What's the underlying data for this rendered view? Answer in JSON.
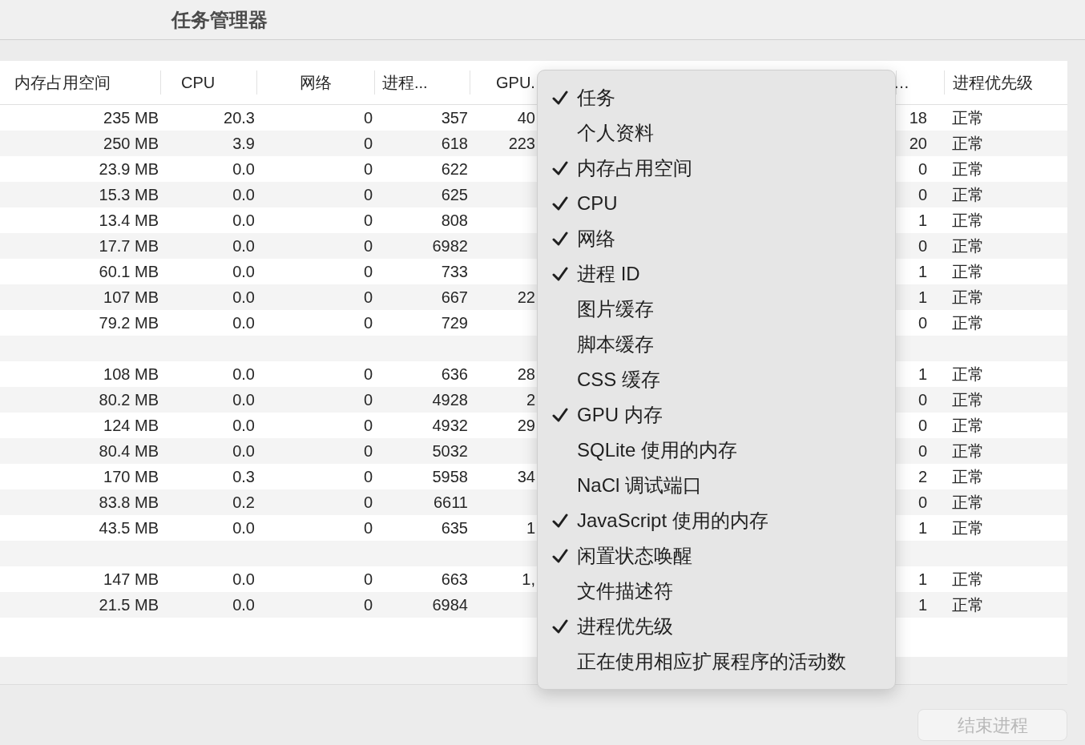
{
  "window": {
    "title": "任务管理器"
  },
  "table": {
    "columns": [
      "内存占用空间",
      "CPU",
      "网络",
      "进程...",
      "GPU.",
      "…",
      "进程优先级"
    ],
    "rows": [
      {
        "kind": "process",
        "memory": "235 MB",
        "cpu": "20.3",
        "network": "0",
        "pid": "357",
        "gpu": "40",
        "column_7": "18",
        "priority": "正常"
      },
      {
        "kind": "process",
        "memory": "250 MB",
        "cpu": "3.9",
        "network": "0",
        "pid": "618",
        "gpu": "223",
        "column_7": "20",
        "priority": "正常"
      },
      {
        "kind": "process",
        "memory": "23.9 MB",
        "cpu": "0.0",
        "network": "0",
        "pid": "622",
        "column_7": "0",
        "priority": "正常"
      },
      {
        "kind": "process",
        "memory": "15.3 MB",
        "cpu": "0.0",
        "network": "0",
        "pid": "625",
        "column_7": "0",
        "priority": "正常"
      },
      {
        "kind": "process",
        "memory": "13.4 MB",
        "cpu": "0.0",
        "network": "0",
        "pid": "808",
        "column_7": "1",
        "priority": "正常"
      },
      {
        "kind": "process",
        "memory": "17.7 MB",
        "cpu": "0.0",
        "network": "0",
        "pid": "6982",
        "column_7": "0",
        "priority": "正常"
      },
      {
        "kind": "process",
        "memory": "60.1 MB",
        "cpu": "0.0",
        "network": "0",
        "pid": "733",
        "column_7": "1",
        "priority": "正常"
      },
      {
        "kind": "process",
        "memory": "107 MB",
        "cpu": "0.0",
        "network": "0",
        "pid": "667",
        "gpu": "22",
        "column_7": "1",
        "priority": "正常"
      },
      {
        "kind": "process",
        "memory": "79.2 MB",
        "cpu": "0.0",
        "network": "0",
        "pid": "729",
        "column_7": "0",
        "priority": "正常"
      },
      {
        "kind": "blank"
      },
      {
        "kind": "process",
        "memory": "108 MB",
        "cpu": "0.0",
        "network": "0",
        "pid": "636",
        "gpu": "28",
        "column_7": "1",
        "priority": "正常"
      },
      {
        "kind": "process",
        "memory": "80.2 MB",
        "cpu": "0.0",
        "network": "0",
        "pid": "4928",
        "gpu": "2",
        "column_7": "0",
        "priority": "正常"
      },
      {
        "kind": "process",
        "memory": "124 MB",
        "cpu": "0.0",
        "network": "0",
        "pid": "4932",
        "gpu": "29",
        "column_7": "0",
        "priority": "正常"
      },
      {
        "kind": "process",
        "memory": "80.4 MB",
        "cpu": "0.0",
        "network": "0",
        "pid": "5032",
        "column_7": "0",
        "priority": "正常"
      },
      {
        "kind": "process",
        "memory": "170 MB",
        "cpu": "0.3",
        "network": "0",
        "pid": "5958",
        "gpu": "34",
        "column_7": "2",
        "priority": "正常"
      },
      {
        "kind": "process",
        "memory": "83.8 MB",
        "cpu": "0.2",
        "network": "0",
        "pid": "6611",
        "column_7": "0",
        "priority": "正常"
      },
      {
        "kind": "process",
        "memory": "43.5 MB",
        "cpu": "0.0",
        "network": "0",
        "pid": "635",
        "gpu": "1",
        "column_7": "1",
        "priority": "正常"
      },
      {
        "kind": "blank"
      },
      {
        "kind": "process",
        "memory": "147 MB",
        "cpu": "0.0",
        "network": "0",
        "pid": "663",
        "gpu": "1,",
        "column_7": "1",
        "priority": "正常"
      },
      {
        "kind": "process",
        "memory": "21.5 MB",
        "cpu": "0.0",
        "network": "0",
        "pid": "6984",
        "column_7": "1",
        "priority": "正常"
      }
    ]
  },
  "column_menu": {
    "items": [
      {
        "label": "任务",
        "checked": true
      },
      {
        "label": "个人资料",
        "checked": false
      },
      {
        "label": "内存占用空间",
        "checked": true
      },
      {
        "label": "CPU",
        "checked": true
      },
      {
        "label": "网络",
        "checked": true
      },
      {
        "label": "进程 ID",
        "checked": true
      },
      {
        "label": "图片缓存",
        "checked": false
      },
      {
        "label": "脚本缓存",
        "checked": false
      },
      {
        "label": "CSS 缓存",
        "checked": false
      },
      {
        "label": "GPU 内存",
        "checked": true
      },
      {
        "label": "SQLite 使用的内存",
        "checked": false
      },
      {
        "label": "NaCl 调试端口",
        "checked": false
      },
      {
        "label": "JavaScript 使用的内存",
        "checked": true
      },
      {
        "label": "闲置状态唤醒",
        "checked": true
      },
      {
        "label": "文件描述符",
        "checked": false
      },
      {
        "label": "进程优先级",
        "checked": true
      },
      {
        "label": "正在使用相应扩展程序的活动数",
        "checked": false
      }
    ]
  },
  "end_process_button": {
    "label": "结束进程",
    "disabled": true
  }
}
